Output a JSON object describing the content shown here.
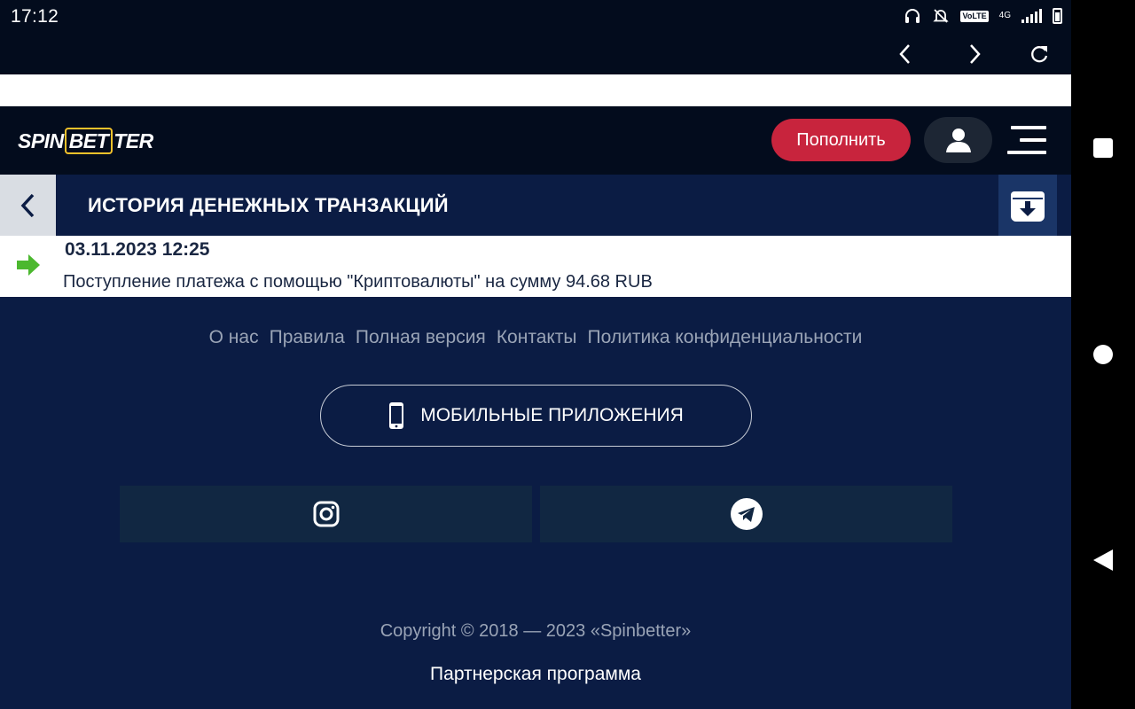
{
  "status_bar": {
    "time": "17:12",
    "volte": "VoLTE",
    "network": "4G"
  },
  "browser": {
    "back_icon": "chevron-left-icon",
    "forward_icon": "chevron-right-icon",
    "reload_icon": "reload-icon"
  },
  "header": {
    "logo_pre": "SPIN",
    "logo_mid": "BET",
    "logo_post": "TER",
    "deposit_label": "Пополнить"
  },
  "page": {
    "title": "ИСТОРИЯ ДЕНЕЖНЫХ ТРАНЗАКЦИЙ"
  },
  "transactions": [
    {
      "date": "03.11.2023 12:25",
      "description": "Поступление платежа с помощью \"Криптовалюты\" на сумму 94.68 RUB",
      "direction_color": "#4cb82f"
    }
  ],
  "footer": {
    "links": [
      "О нас",
      "Правила",
      "Полная версия",
      "Контакты",
      "Политика конфиденциальности"
    ],
    "apps_label": "МОБИЛЬНЫЕ ПРИЛОЖЕНИЯ",
    "social": [
      "instagram-icon",
      "telegram-icon"
    ],
    "copyright": "Copyright © 2018 — 2023 «Spinbetter»",
    "partner": "Партнерская программа"
  },
  "colors": {
    "brand_dark": "#030c1d",
    "navy": "#0b1c44",
    "deposit": "#c8243d",
    "logo_accent": "#f4c22b"
  }
}
